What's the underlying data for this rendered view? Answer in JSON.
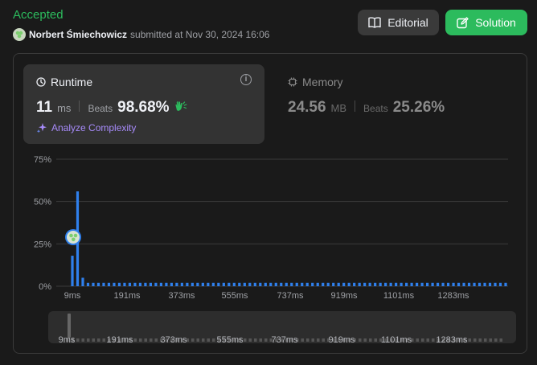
{
  "header": {
    "status": "Accepted",
    "user_name": "Norbert Śmiechowicz",
    "submitted_text": "submitted at Nov 30, 2024 16:06",
    "editorial_label": "Editorial",
    "solution_label": "Solution"
  },
  "runtime": {
    "title": "Runtime",
    "value": "11",
    "unit": "ms",
    "beats_label": "Beats",
    "beats_pct": "98.68%",
    "analyze_label": "Analyze Complexity",
    "info_glyph": "i"
  },
  "memory": {
    "title": "Memory",
    "value": "24.56",
    "unit": "MB",
    "beats_label": "Beats",
    "beats_pct": "25.26%"
  },
  "colors": {
    "accent_green": "#2cbb5d",
    "bar_blue": "#2f80ed",
    "analyze_purple": "#a78bfa"
  },
  "chart_data": {
    "type": "bar",
    "ylim": [
      0,
      75
    ],
    "y_ticks": [
      "0%",
      "25%",
      "50%",
      "75%"
    ],
    "x_ticks": [
      "9ms",
      "191ms",
      "373ms",
      "555ms",
      "737ms",
      "919ms",
      "1101ms",
      "1283ms"
    ],
    "values": [
      18,
      56,
      5,
      2,
      2,
      2,
      2,
      2,
      2,
      2,
      2,
      2,
      2,
      2,
      2,
      2,
      2,
      2,
      2,
      2,
      2,
      2,
      2,
      2,
      2,
      2,
      2,
      2,
      2,
      2,
      2,
      2,
      2,
      2,
      2,
      2,
      2,
      2,
      2,
      2,
      2,
      2,
      2,
      2,
      2,
      2,
      2,
      2,
      2,
      2,
      2,
      2,
      2,
      2,
      2,
      2,
      2,
      2,
      2,
      2,
      2,
      2,
      2,
      2,
      2,
      2,
      2,
      2,
      2,
      2,
      2,
      2,
      2,
      2,
      2,
      2,
      2,
      2,
      2,
      2,
      2,
      2,
      2,
      2
    ],
    "highlight_index": 0,
    "grid": true
  },
  "scrubber": {
    "ticks": [
      "9ms",
      "191ms",
      "373ms",
      "555ms",
      "737ms",
      "919ms",
      "1101ms",
      "1283ms"
    ]
  }
}
